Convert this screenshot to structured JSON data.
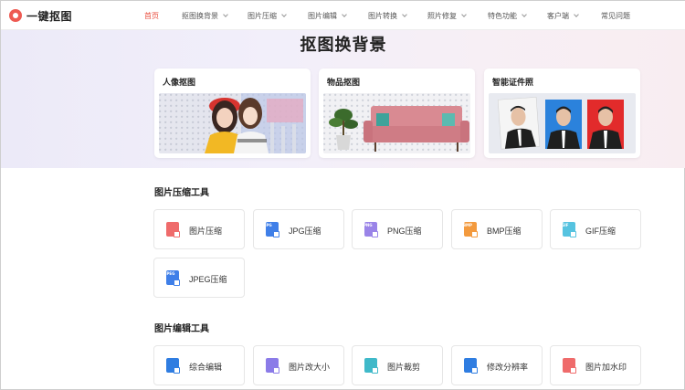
{
  "header": {
    "logo_text": "一键抠图",
    "nav": [
      {
        "label": "首页",
        "active": true,
        "dropdown": false
      },
      {
        "label": "抠图换背景",
        "active": false,
        "dropdown": true
      },
      {
        "label": "图片压缩",
        "active": false,
        "dropdown": true
      },
      {
        "label": "图片编辑",
        "active": false,
        "dropdown": true
      },
      {
        "label": "图片转换",
        "active": false,
        "dropdown": true
      },
      {
        "label": "照片修复",
        "active": false,
        "dropdown": true
      },
      {
        "label": "特色功能",
        "active": false,
        "dropdown": true
      },
      {
        "label": "客户端",
        "active": false,
        "dropdown": true
      },
      {
        "label": "常见问题",
        "active": false,
        "dropdown": false
      }
    ]
  },
  "hero": {
    "title": "抠图换背景",
    "cards": [
      {
        "title": "人像抠图"
      },
      {
        "title": "物品抠图"
      },
      {
        "title": "智能证件照"
      }
    ]
  },
  "compress_section": {
    "title": "图片压缩工具",
    "tools": [
      {
        "label": "图片压缩",
        "icon": "image-compress-icon",
        "color": "#ef6b6b",
        "tag": ""
      },
      {
        "label": "JPG压缩",
        "icon": "jpg-file-icon",
        "color": "#3f7fe8",
        "tag": "JPG"
      },
      {
        "label": "PNG压缩",
        "icon": "png-file-icon",
        "color": "#9a84e8",
        "tag": "PNG"
      },
      {
        "label": "BMP压缩",
        "icon": "bmp-file-icon",
        "color": "#f39a3e",
        "tag": "BMP"
      },
      {
        "label": "GIF压缩",
        "icon": "gif-file-icon",
        "color": "#56c3e0",
        "tag": "GIF"
      },
      {
        "label": "JPEG压缩",
        "icon": "jpeg-file-icon",
        "color": "#3f7fe8",
        "tag": "JPEG"
      }
    ]
  },
  "edit_section": {
    "title": "图片编辑工具",
    "tools": [
      {
        "label": "综合编辑",
        "icon": "edit-image-icon",
        "color": "#2f7de1"
      },
      {
        "label": "图片改大小",
        "icon": "resize-image-icon",
        "color": "#8b7be8"
      },
      {
        "label": "图片裁剪",
        "icon": "crop-image-icon",
        "color": "#3fb9c9"
      },
      {
        "label": "修改分辨率",
        "icon": "resolution-icon",
        "color": "#2f7de1"
      },
      {
        "label": "图片加水印",
        "icon": "watermark-icon",
        "color": "#ef6b6b"
      }
    ]
  }
}
